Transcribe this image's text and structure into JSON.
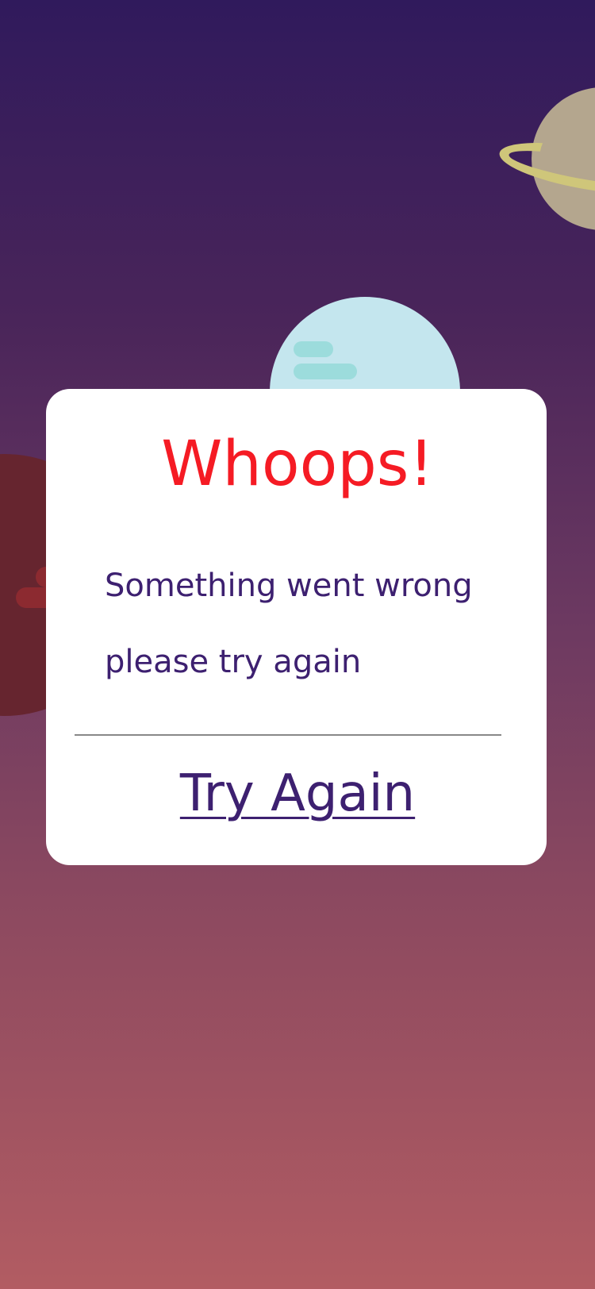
{
  "background": {
    "gradient_top": "#301a5c",
    "gradient_bottom": "#b25c62"
  },
  "dialog": {
    "title": "Whoops!",
    "message_line1": "Something went wrong",
    "message_line2": "please try again",
    "action_label": "Try Again"
  },
  "colors": {
    "title": "#f51b24",
    "text": "#3d2070",
    "card": "#ffffff"
  }
}
